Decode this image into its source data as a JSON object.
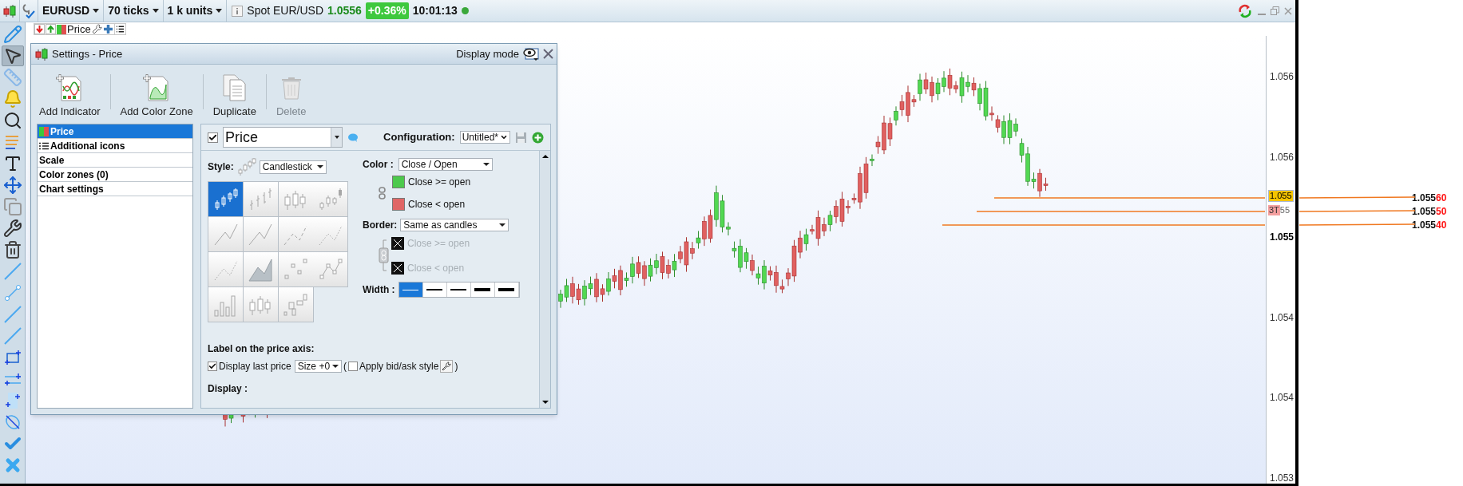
{
  "top_bar": {
    "instrument": "EURUSD",
    "ticks": "70 ticks",
    "units": "1 k units",
    "spot_label": "Spot EUR/USD",
    "spot_price": "1.0556",
    "change": "+0.36%",
    "time": "10:01:13",
    "connected": true
  },
  "legend": {
    "label": "Price"
  },
  "tools": [
    {
      "kind": "pencil",
      "selected": false
    },
    {
      "kind": "pointer",
      "selected": true
    },
    {
      "kind": "ruler",
      "selected": false
    },
    {
      "kind": "bell",
      "selected": false
    },
    {
      "kind": "search",
      "selected": false
    },
    {
      "kind": "fibonacci",
      "selected": false
    },
    {
      "kind": "text",
      "selected": false
    },
    {
      "kind": "move",
      "selected": false
    },
    {
      "kind": "copy",
      "selected": false
    },
    {
      "kind": "tools",
      "selected": false
    },
    {
      "kind": "trash",
      "selected": false
    },
    {
      "kind": "line",
      "selected": false
    },
    {
      "kind": "segment",
      "selected": false
    },
    {
      "kind": "line",
      "selected": false
    },
    {
      "kind": "line",
      "selected": false
    },
    {
      "kind": "rectangle",
      "selected": false
    },
    {
      "kind": "channel",
      "selected": false
    },
    {
      "kind": "range",
      "selected": false
    },
    {
      "kind": "ellipse",
      "selected": false
    },
    {
      "kind": "check",
      "selected": false
    },
    {
      "kind": "close",
      "selected": false
    }
  ],
  "dialog": {
    "title": "Settings - Price",
    "display_mode": "Display mode",
    "actions": [
      {
        "label": "Add Indicator",
        "kind": "indicator",
        "disabled": false
      },
      {
        "label": "Add Color Zone",
        "kind": "zone",
        "disabled": false
      },
      {
        "label": "Duplicate",
        "kind": "duplicate",
        "disabled": false
      },
      {
        "label": "Delete",
        "kind": "delete",
        "disabled": true
      }
    ],
    "nav": [
      {
        "label": "Price",
        "kind": "price",
        "selected": true
      },
      {
        "label": "Additional icons",
        "kind": "list",
        "selected": false
      },
      {
        "label": "Scale",
        "kind": "plain",
        "selected": false
      },
      {
        "label": "Color zones (0)",
        "kind": "plain",
        "selected": false
      },
      {
        "label": "Chart settings",
        "kind": "plain",
        "selected": false
      }
    ],
    "panel": {
      "enabled": true,
      "name": "Price",
      "configuration_label": "Configuration:",
      "configuration": "Untitled*",
      "style_label": "Style:",
      "style": "Candlestick",
      "styles": [
        {
          "kind": "candles",
          "selected": true
        },
        {
          "kind": "bars",
          "selected": false
        },
        {
          "kind": "hollow",
          "selected": false
        },
        {
          "kind": "dots-candles",
          "selected": false
        },
        {
          "kind": "line",
          "selected": false
        },
        {
          "kind": "line",
          "selected": false
        },
        {
          "kind": "dashed",
          "selected": false
        },
        {
          "kind": "dotted",
          "selected": false
        },
        {
          "kind": "dotted",
          "selected": false
        },
        {
          "kind": "area",
          "selected": false
        },
        {
          "kind": "points",
          "selected": false
        },
        {
          "kind": "line-points",
          "selected": false
        },
        {
          "kind": "volume",
          "selected": false
        },
        {
          "kind": "hollow",
          "selected": false
        },
        {
          "kind": "boxes",
          "selected": false
        }
      ],
      "color_label": "Color :",
      "color_mode": "Close / Open",
      "colors": [
        {
          "label": "Close >= open",
          "color": "#4cc94c"
        },
        {
          "label": "Close < open",
          "color": "#e06666"
        }
      ],
      "border_label": "Border:",
      "border": "Same as candles",
      "borders": [
        {
          "label": "Close >= open",
          "disabled": true
        },
        {
          "label": "Close < open",
          "disabled": true
        }
      ],
      "width_label": "Width :",
      "widths": [
        {
          "selected": true
        },
        {
          "selected": false
        },
        {
          "selected": false
        },
        {
          "selected": false
        },
        {
          "selected": false
        }
      ],
      "axis_heading": "Label on the price axis:",
      "last_price": {
        "label": "Display last price",
        "checked": true
      },
      "size": "Size +0",
      "paren_open": "(",
      "paren_close": ")",
      "bid_ask": {
        "label": "Apply bid/ask style",
        "checked": false
      },
      "display_heading": "Display :"
    }
  },
  "axis": {
    "ticks": [
      {
        "label": "1.056",
        "bold": false
      },
      {
        "label": "1.056",
        "bold": false
      },
      {
        "label": "1.055",
        "bold": true
      },
      {
        "label": "1.054",
        "bold": false
      },
      {
        "label": "1.054",
        "bold": false
      },
      {
        "label": "1.053",
        "bold": false
      }
    ],
    "last_marker": {
      "label": "1.055",
      "color": "#f5c400"
    },
    "bid_marker": {
      "label": "3T",
      "value": "55",
      "color": "#f4a0a0"
    }
  },
  "price_levels": [
    {
      "main": "1.055",
      "tail": "60"
    },
    {
      "main": "1.055",
      "tail": "50"
    },
    {
      "main": "1.055",
      "tail": "40"
    }
  ]
}
